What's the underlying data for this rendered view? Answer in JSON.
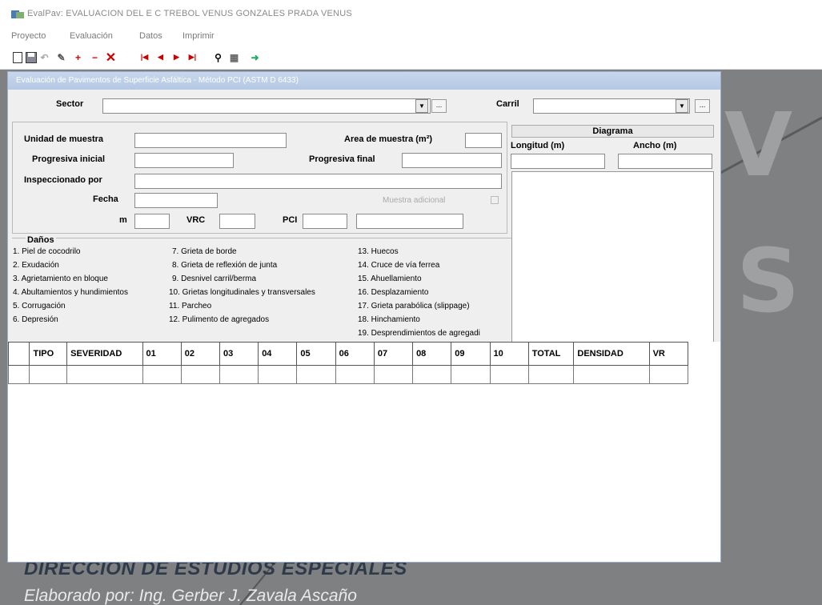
{
  "window_title": "EvalPav: EVALUACION DEL E C TREBOL VENUS GONZALES PRADA VENUS",
  "menu": [
    {
      "label": "Proyecto"
    },
    {
      "label": "Evaluación"
    },
    {
      "label": "Datos"
    },
    {
      "label": "Imprimir"
    }
  ],
  "form_title": "Evaluación de Pavimentos de Superficie Asfáltica - Método PCI (ASTM D 6433)",
  "fields": {
    "sector": "Sector",
    "carril": "Carril",
    "ellipsis": "...",
    "unidad_muestra": "Unidad de muestra",
    "area_muestra": "Area de muestra (m²)",
    "progresiva_inicial": "Progresiva inicial",
    "progresiva_final": "Progresiva final",
    "inspeccionado_por": "Inspeccionado por",
    "fecha": "Fecha",
    "muestra_adicional": "Muestra adicional",
    "m": "m",
    "vrc": "VRC",
    "pci": "PCI"
  },
  "diagrama": {
    "title": "Diagrama",
    "longitud": "Longitud (m)",
    "ancho": "Ancho (m)"
  },
  "danos": {
    "title": "Daños",
    "col1": [
      "1. Piel de cocodrilo",
      "2. Exudación",
      "3. Agrietamiento en bloque",
      "4. Abultamientos y hundimientos",
      "5. Corrugación",
      "6. Depresión"
    ],
    "col2": [
      "7. Grieta de borde",
      "8. Grieta de reflexión de junta",
      "9. Desnivel carril/berma",
      "10. Grietas longitudinales y transversales",
      "11. Parcheo",
      "12. Pulimento de agregados"
    ],
    "col3": [
      "13. Huecos",
      "14. Cruce de vía ferrea",
      "15. Ahuellamiento",
      "16. Desplazamiento",
      "17. Grieta parabólica (slippage)",
      "18. Hinchamiento",
      "19. Desprendimientos de agregadi"
    ]
  },
  "grid": {
    "headers": [
      "",
      "TIPO",
      "SEVERIDAD",
      "01",
      "02",
      "03",
      "04",
      "05",
      "06",
      "07",
      "08",
      "09",
      "10",
      "TOTAL",
      "DENSIDAD",
      "VR"
    ]
  },
  "background": {
    "line1": "DIRECCION DE ESTUDIOS ESPECIALES",
    "line2": "Elaborado por: Ing. Gerber J. Zavala Ascaño",
    "letters": [
      "V",
      "S"
    ]
  }
}
